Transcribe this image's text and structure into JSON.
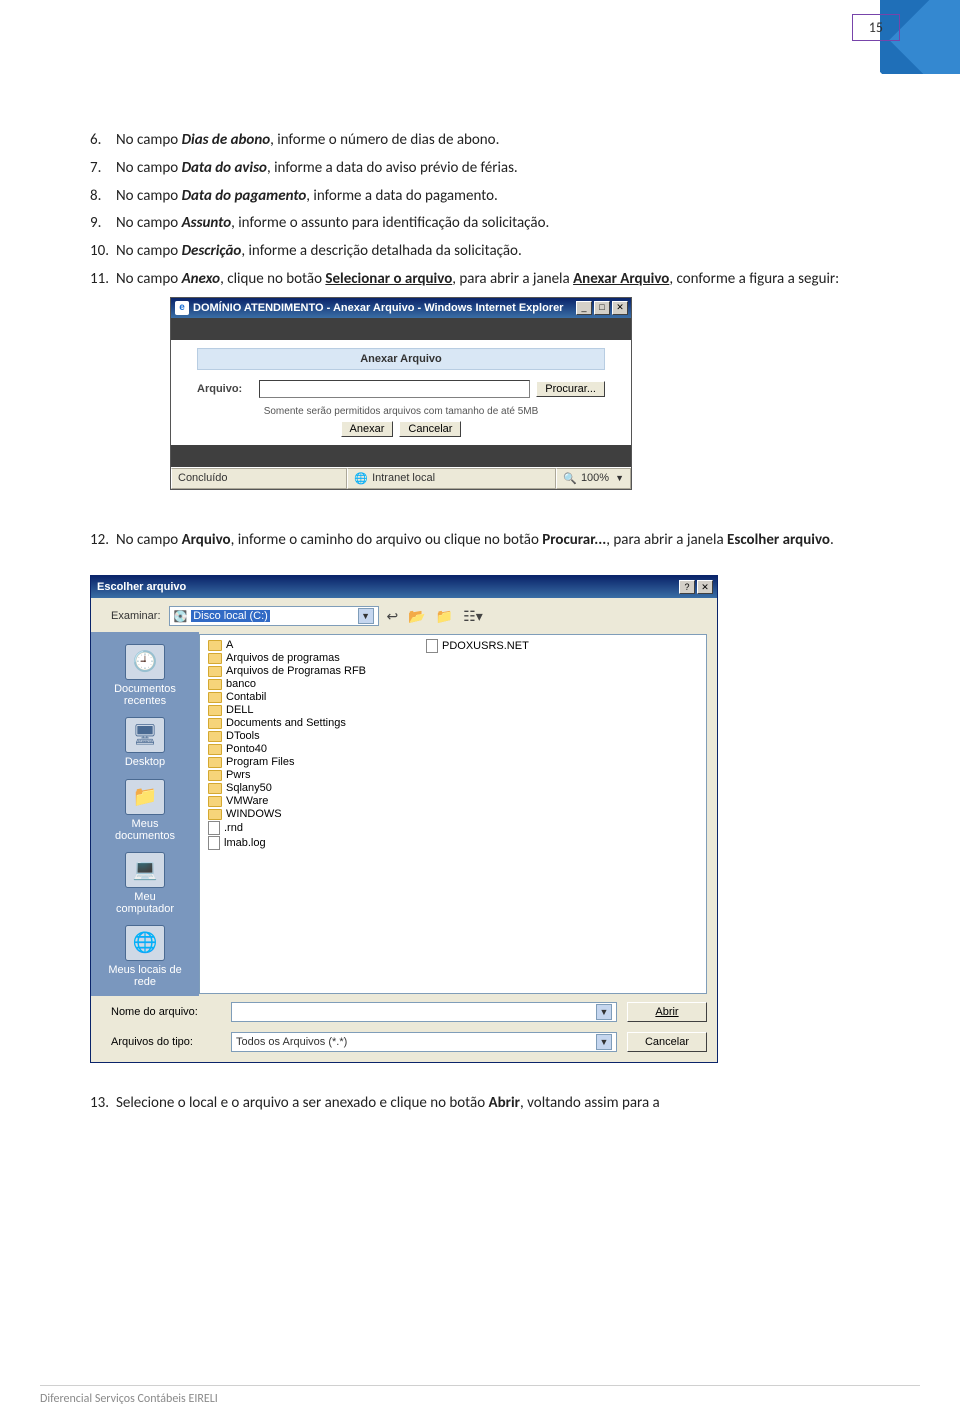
{
  "page_number": "15",
  "list": {
    "i6": {
      "num": "6.",
      "a": "No campo ",
      "b": "Dias de abono",
      "c": ", informe o número de dias de abono."
    },
    "i7": {
      "num": "7.",
      "a": "No campo ",
      "b": "Data do aviso",
      "c": ", informe a data do aviso prévio de férias."
    },
    "i8": {
      "num": "8.",
      "a": "No campo ",
      "b": "Data do pagamento",
      "c": ", informe a data do pagamento."
    },
    "i9": {
      "num": "9.",
      "a": "No campo ",
      "b": "Assunto",
      "c": ", informe o assunto para identificação da solicitação."
    },
    "i10": {
      "num": "10.",
      "a": "No campo ",
      "b": "Descrição",
      "c": ", informe a descrição detalhada da solicitação."
    },
    "i11": {
      "num": "11.",
      "a": "No campo ",
      "b": "Anexo",
      "c": ", clique no botão ",
      "d": "Selecionar o arquivo",
      "e": ", para abrir a janela ",
      "f": "Anexar Arquivo",
      "g": ", conforme a figura a seguir:"
    },
    "i12": {
      "num": "12.",
      "a": "No campo ",
      "b": "Arquivo",
      "c": ", informe o caminho do arquivo ou clique no botão ",
      "d": "Procurar...",
      "e": ", para abrir a janela ",
      "f": "Escolher arquivo",
      "g": "."
    },
    "i13": {
      "num": "13.",
      "a": "Selecione o local e o arquivo a ser anexado e clique no botão ",
      "b": "Abrir",
      "c": ", voltando assim para a"
    }
  },
  "ie": {
    "title": "DOMÍNIO ATENDIMENTO - Anexar Arquivo - Windows Internet Explorer",
    "header": "Anexar Arquivo",
    "lbl_arquivo": "Arquivo:",
    "btn_procurar": "Procurar...",
    "note": "Somente serão permitidos arquivos com tamanho de até 5MB",
    "btn_anexar": "Anexar",
    "btn_cancelar": "Cancelar",
    "status_done": "Concluído",
    "status_intranet": "Intranet local",
    "status_zoom": "100%"
  },
  "fd": {
    "title": "Escolher arquivo",
    "lbl_examinar": "Examinar:",
    "drive": "Disco local (C:)",
    "places": {
      "recent1": "Documentos",
      "recent2": "recentes",
      "desktop": "Desktop",
      "docs1": "Meus",
      "docs2": "documentos",
      "pc1": "Meu",
      "pc2": "computador",
      "net1": "Meus locais de",
      "net2": "rede"
    },
    "files_col1": [
      "A",
      "Arquivos de programas",
      "Arquivos de Programas RFB",
      "banco",
      "Contabil",
      "DELL",
      "Documents and Settings",
      "DTools",
      "Ponto40",
      "Program Files",
      "Pwrs",
      "Sqlany50",
      "VMWare",
      "WINDOWS",
      ".rnd",
      "lmab.log"
    ],
    "files_col2": [
      "PDOXUSRS.NET"
    ],
    "lbl_nome": "Nome do arquivo:",
    "lbl_tipo": "Arquivos do tipo:",
    "type_value": "Todos os Arquivos (*.*)",
    "btn_abrir": "Abrir",
    "btn_cancelar": "Cancelar"
  },
  "footer": "Diferencial Serviços Contábeis EIRELI"
}
